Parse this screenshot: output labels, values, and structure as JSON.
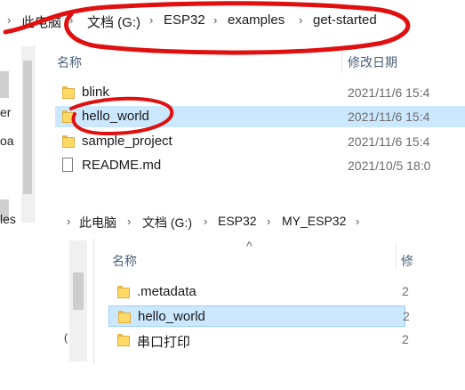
{
  "top_window": {
    "breadcrumb": [
      "此电脑",
      "文档 (G:)",
      "ESP32",
      "examples",
      "get-started"
    ],
    "columns": {
      "name": "名称",
      "modified": "修改日期"
    },
    "left_fragments": [
      "er",
      "oa",
      "les"
    ],
    "files": [
      {
        "name": "blink",
        "type": "folder",
        "modified": "2021/11/6 15:4"
      },
      {
        "name": "hello_world",
        "type": "folder",
        "modified": "2021/11/6 15:4",
        "selected": true
      },
      {
        "name": "sample_project",
        "type": "folder",
        "modified": "2021/11/6 15:4"
      },
      {
        "name": "README.md",
        "type": "file",
        "modified": "2021/10/5 18:0"
      }
    ]
  },
  "second_window": {
    "breadcrumb": [
      "此电脑",
      "文档 (G:)",
      "ESP32",
      "MY_ESP32"
    ],
    "columns": {
      "name": "名称",
      "clip": "修"
    },
    "left_fragment": "(",
    "files": [
      {
        "name": ".metadata",
        "type": "folder",
        "clip": "2"
      },
      {
        "name": "hello_world",
        "type": "folder",
        "clip": "2",
        "selected": true
      },
      {
        "name": "串口打印",
        "type": "folder",
        "clip": "2"
      }
    ]
  },
  "annotation_color": "#e01010"
}
